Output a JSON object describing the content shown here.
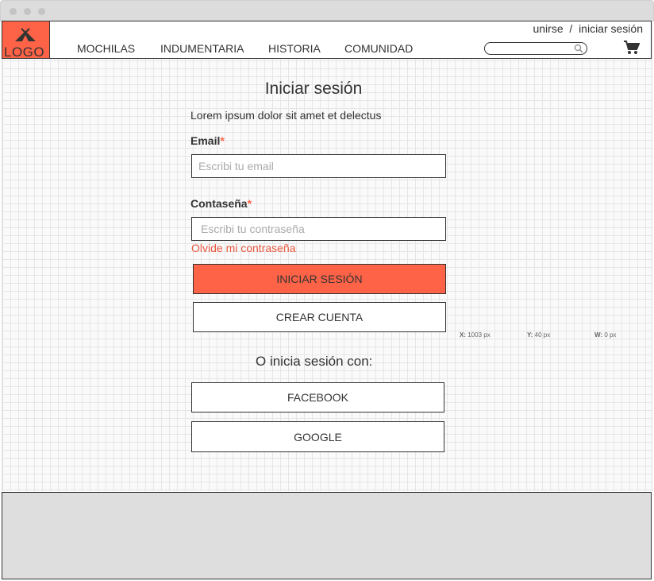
{
  "window": {
    "controls": [
      "close",
      "minimize",
      "maximize"
    ]
  },
  "header": {
    "logo_text": "LOGO",
    "nav": [
      "MOCHILAS",
      "INDUMENTARIA",
      "HISTORIA",
      "COMUNIDAD"
    ],
    "top_links": {
      "join": "unirse",
      "separator": "/",
      "login": "iniciar sesión"
    },
    "search_placeholder": "",
    "cart_icon": "shopping-cart-icon"
  },
  "login": {
    "title": "Iniciar sesión",
    "description": "Lorem ipsum dolor sit amet et delectus",
    "email_label": "Email",
    "email_placeholder": "Escribi tu email",
    "password_label": "Contaseña",
    "password_placeholder": "Escribi tu contraseña",
    "required_mark": "*",
    "forgot": "Olvide mi contraseña",
    "submit": "INICIAR SESIÓN",
    "create_account": "CREAR CUENTA",
    "alt_title": "O inicia sesión con:",
    "facebook": "FACEBOOK",
    "google": "GOOGLE"
  },
  "coords_readout": {
    "x_label": "X:",
    "x_value": "1003 px",
    "y_label": "Y:",
    "y_value": "40 px",
    "w_label": "W:",
    "w_value": "0 px"
  },
  "colors": {
    "accent": "#ff6347",
    "footer": "#dedede",
    "border": "#333333"
  }
}
